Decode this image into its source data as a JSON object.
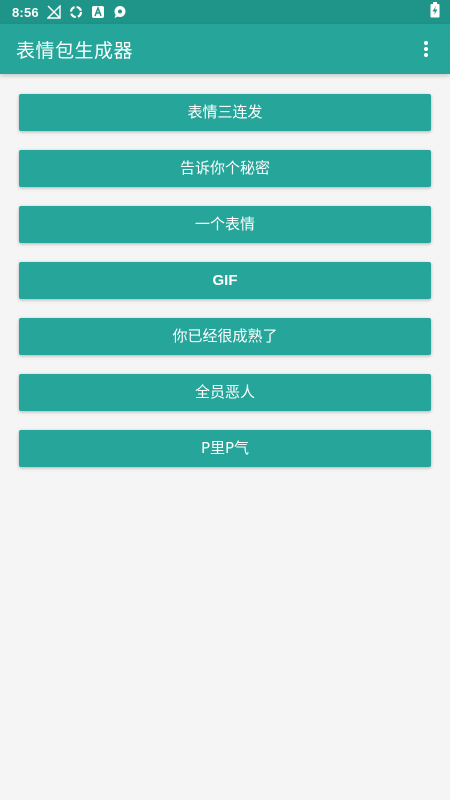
{
  "status_bar": {
    "time": "8:56",
    "icons": [
      "signal-off-icon",
      "sync-icon",
      "app-a-icon",
      "chat-icon"
    ],
    "battery_icon": "battery-charging-icon"
  },
  "app_bar": {
    "title": "表情包生成器",
    "overflow_icon": "more-vert-icon"
  },
  "menu": {
    "items": [
      {
        "label": "表情三连发"
      },
      {
        "label": "告诉你个秘密"
      },
      {
        "label": "一个表情"
      },
      {
        "label": "GIF"
      },
      {
        "label": "你已经很成熟了"
      },
      {
        "label": "全员恶人"
      },
      {
        "label": "P里P气"
      }
    ]
  },
  "colors": {
    "primary": "#26a69a",
    "primary_dark": "#1f9488",
    "background": "#f5f5f5",
    "text_on_primary": "#ffffff"
  }
}
